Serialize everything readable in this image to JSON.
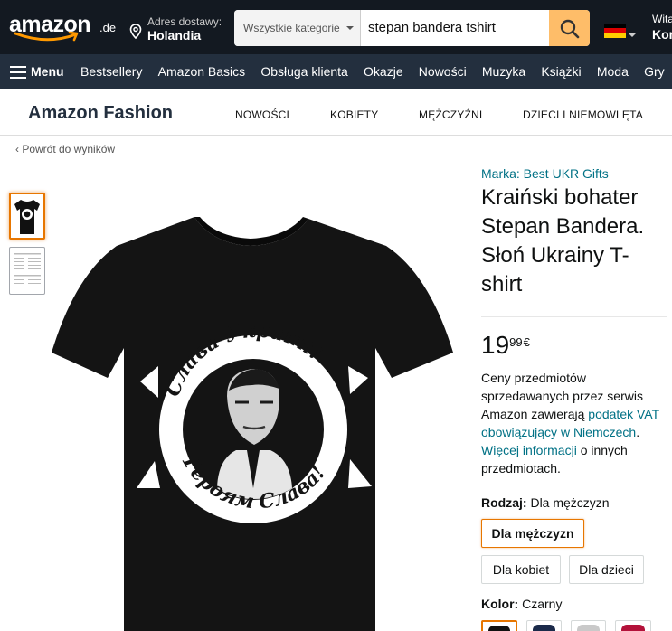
{
  "header": {
    "logo_text": "amazon",
    "logo_tld": ".de",
    "delivery_line1": "Adres dostawy:",
    "delivery_line2": "Holandia",
    "search_category": "Wszystkie kategorie",
    "search_query": "stepan bandera tshirt",
    "account_line1": "Witaj",
    "account_line2": "Kon",
    "colors": {
      "header_bg": "#131921",
      "nav_bg": "#232f3e",
      "search_button": "#febd69",
      "accent": "#e77600",
      "link": "#007185"
    }
  },
  "nav": {
    "menu_label": "Menu",
    "links": [
      "Bestsellery",
      "Amazon Basics",
      "Obsługa klienta",
      "Okazje",
      "Nowości",
      "Muzyka",
      "Książki",
      "Moda",
      "Gry"
    ]
  },
  "fashion_nav": {
    "title": "Amazon Fashion",
    "links": [
      "NOWOŚCI",
      "KOBIETY",
      "MĘŻCZYŹNI",
      "DZIECI I NIEMOWLĘTA"
    ]
  },
  "back_link": "‹ Powrót do wyników",
  "product": {
    "brand": "Marka: Best UKR Gifts",
    "title": "Kraiński bohater Stepan Bandera. Słoń Ukrainy T-shirt",
    "price_whole": "19",
    "price_fraction": "99",
    "price_currency": "€",
    "vat_text_1": "Ceny przedmiotów sprzedawanych przez serwis Amazon zawierają ",
    "vat_link": "podatek VAT obowiązujący w Niemczech",
    "vat_text_2": ".",
    "info_link": "Więcej informacji",
    "vat_text_3": " o innych przedmiotach.",
    "print_top_text": "Слава Україні!",
    "print_bottom_text": "Героям Слава!"
  },
  "variant": {
    "type_label": "Rodzaj:",
    "type_value": "Dla mężczyzn",
    "options": [
      "Dla mężczyzn",
      "Dla kobiet",
      "Dla dzieci"
    ],
    "selected_option": "Dla mężczyzn",
    "color_label": "Kolor:",
    "color_value": "Czarny",
    "swatch_colors": [
      "#111111",
      "#1b2a4a",
      "#c9c9c9",
      "#2a3e8c",
      "#b3123a"
    ]
  }
}
